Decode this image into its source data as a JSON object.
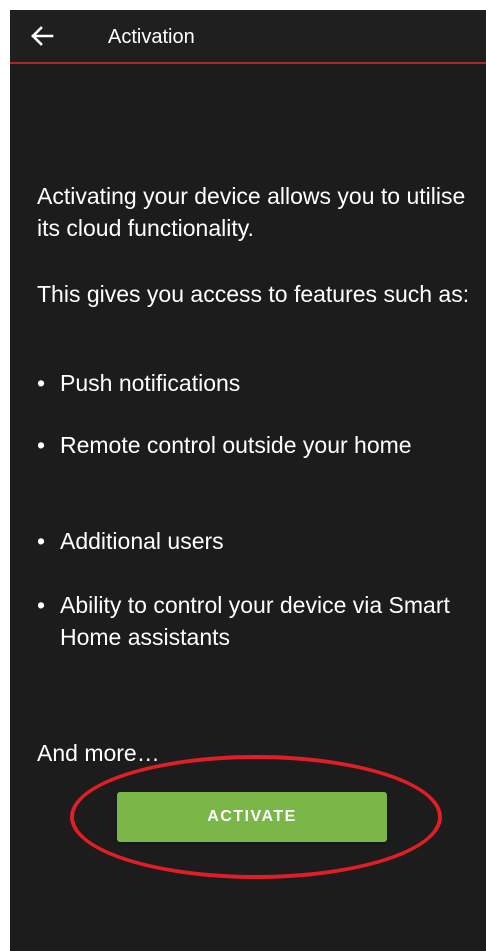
{
  "appbar": {
    "title": "Activation",
    "back_icon": "arrow-left-icon"
  },
  "content": {
    "paragraph_1": "Activating your device allows you to utilise its cloud functionality.",
    "paragraph_2": "This gives you access to features such as:",
    "bullet_glyph": "•",
    "features": [
      "Push notifications",
      "Remote control outside your home",
      "Additional users",
      "Ability to control your device via Smart Home assistants"
    ],
    "closing": "And more…"
  },
  "actions": {
    "activate_label": "ACTIVATE"
  },
  "colors": {
    "background": "#1c1c1c",
    "appbar_divider": "#b0252b",
    "button": "#7ab648",
    "highlight_ring": "#e01e25",
    "text": "#ffffff"
  }
}
